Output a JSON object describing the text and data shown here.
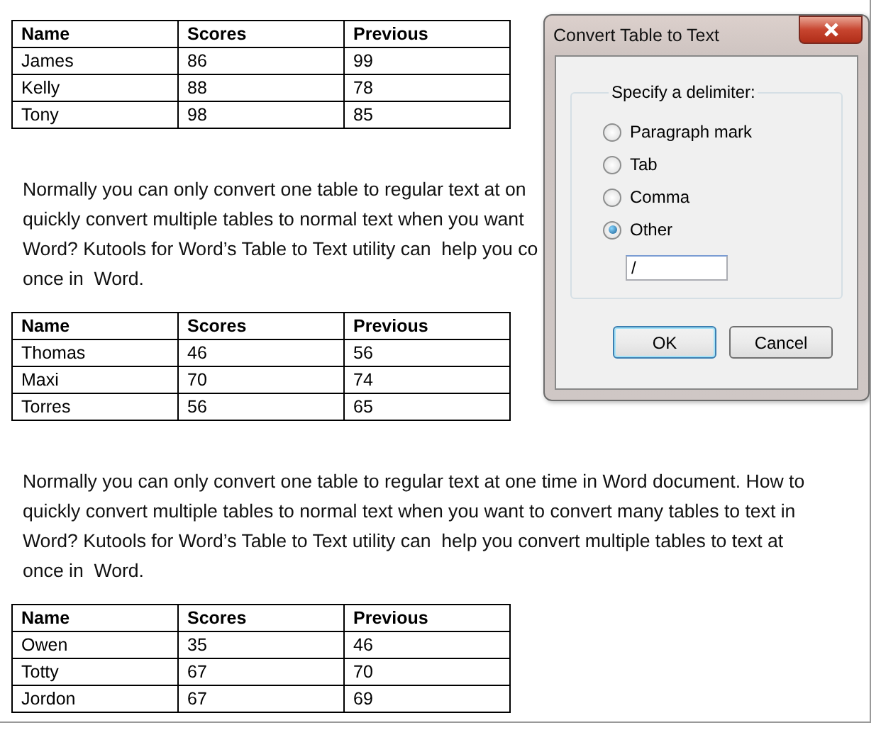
{
  "document": [
    {
      "kind": "table",
      "columns": [
        "Name",
        "Scores",
        "Previous"
      ],
      "rows": [
        [
          "James",
          "86",
          "99"
        ],
        [
          "Kelly",
          "88",
          "78"
        ],
        [
          "Tony",
          "98",
          "85"
        ]
      ]
    },
    {
      "kind": "paragraph",
      "lines": [
        "Normally you can only convert one table to regular text at on",
        "quickly convert multiple tables to normal text when you want",
        "Word? Kutools for Word’s Table to Text utility can  help you co",
        "once in  Word."
      ]
    },
    {
      "kind": "table",
      "columns": [
        "Name",
        "Scores",
        "Previous"
      ],
      "rows": [
        [
          "Thomas",
          "46",
          "56"
        ],
        [
          "Maxi",
          "70",
          "74"
        ],
        [
          "Torres",
          "56",
          "65"
        ]
      ]
    },
    {
      "kind": "paragraph",
      "lines": [
        "Normally you can only convert one table to regular text at one time in Word document. How to",
        "quickly convert multiple tables to normal text when you want to convert many tables to text in",
        "Word? Kutools for Word’s Table to Text utility can  help you convert multiple tables to text at",
        "once in  Word."
      ]
    },
    {
      "kind": "table",
      "columns": [
        "Name",
        "Scores",
        "Previous"
      ],
      "rows": [
        [
          "Owen",
          "35",
          "46"
        ],
        [
          "Totty",
          "67",
          "70"
        ],
        [
          "Jordon",
          "67",
          "69"
        ]
      ]
    }
  ],
  "dialog": {
    "title": "Convert Table to Text",
    "group_label": "Specify a delimiter:",
    "options": [
      {
        "label": "Paragraph mark",
        "selected": false
      },
      {
        "label": "Tab",
        "selected": false
      },
      {
        "label": "Comma",
        "selected": false
      },
      {
        "label": "Other",
        "selected": true
      }
    ],
    "other_value": "/",
    "buttons": [
      {
        "label": "OK",
        "default": true
      },
      {
        "label": "Cancel",
        "default": false
      }
    ]
  }
}
